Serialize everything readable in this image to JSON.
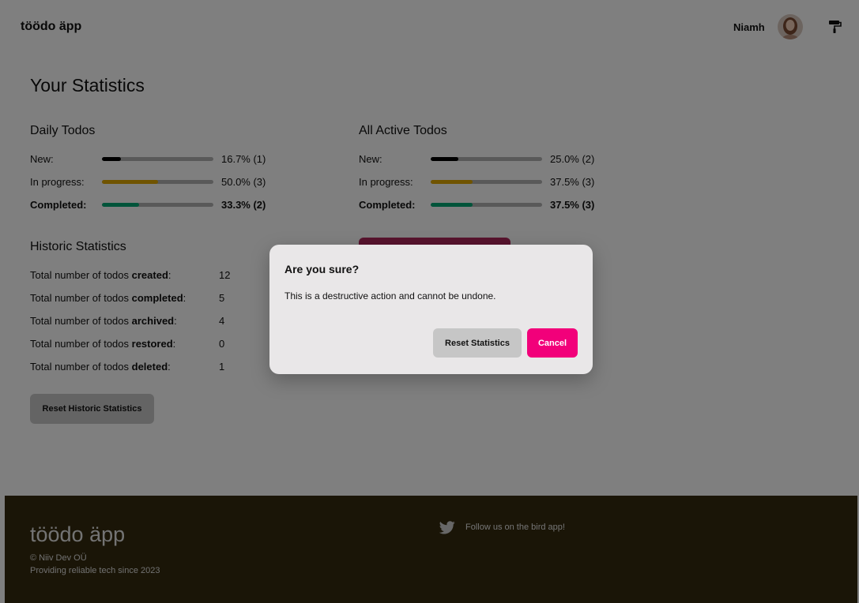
{
  "header": {
    "logo": "töödo äpp",
    "user_name": "Niamh",
    "avatar_icon": "user-avatar",
    "theme_icon": "paint-roller-icon"
  },
  "main": {
    "title": "Your Statistics",
    "daily": {
      "title": "Daily Todos",
      "rows": [
        {
          "label": "New:",
          "value": "16.7% (1)",
          "fraction": 0.167,
          "color": "#000000"
        },
        {
          "label": "In progress:",
          "value": "50.0% (3)",
          "fraction": 0.5,
          "color": "#e0a800"
        },
        {
          "label": "Completed:",
          "value": "33.3% (2)",
          "fraction": 0.333,
          "color": "#00a874"
        }
      ]
    },
    "active": {
      "title": "All Active Todos",
      "rows": [
        {
          "label": "New:",
          "value": "25.0% (2)",
          "fraction": 0.25,
          "color": "#000000"
        },
        {
          "label": "In progress:",
          "value": "37.5% (3)",
          "fraction": 0.375,
          "color": "#e0a800"
        },
        {
          "label": "Completed:",
          "value": "37.5% (3)",
          "fraction": 0.375,
          "color": "#00a874"
        }
      ]
    },
    "historic": {
      "title": "Historic Statistics",
      "prefix": "Total number of todos ",
      "rows": [
        {
          "keyword": "created",
          "value": "12"
        },
        {
          "keyword": "completed",
          "value": "5"
        },
        {
          "keyword": "archived",
          "value": "4"
        },
        {
          "keyword": "restored",
          "value": "0"
        },
        {
          "keyword": "deleted",
          "value": "1"
        }
      ],
      "reset_button": "Reset Historic Statistics"
    }
  },
  "modal": {
    "title": "Are you sure?",
    "text": "This is a destructive action and cannot be undone.",
    "reset_button": "Reset Statistics",
    "cancel_button": "Cancel"
  },
  "footer": {
    "logo": "töödo äpp",
    "copyright": "© Niiv Dev OÜ",
    "tagline": "Providing reliable tech since 2023",
    "social_icon": "twitter-bird-icon",
    "social_text": "Follow us on the bird app!"
  }
}
